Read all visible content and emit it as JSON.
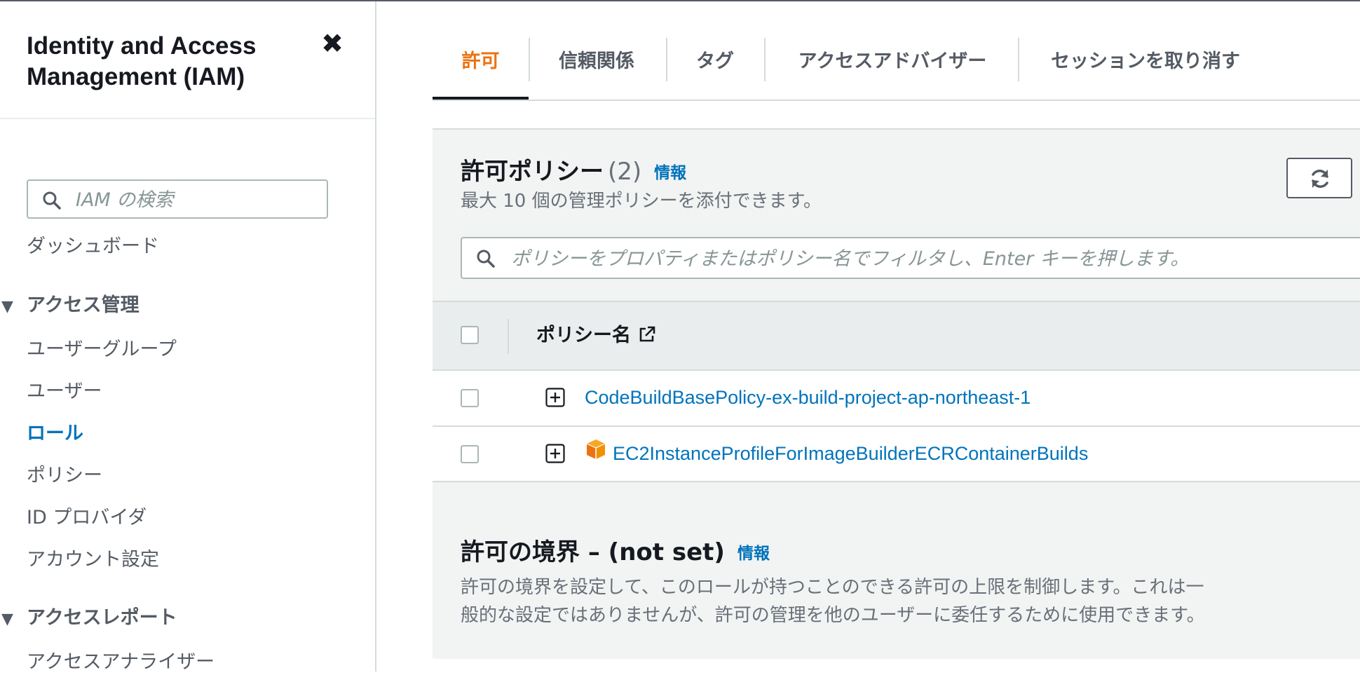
{
  "sidebar": {
    "title": "Identity and Access Management (IAM)",
    "close_icon": "close-icon",
    "search_placeholder": "IAM の検索",
    "dashboard": "ダッシュボード",
    "section_access_mgmt": "アクセス管理",
    "items": [
      {
        "label": "ユーザーグループ",
        "active": false
      },
      {
        "label": "ユーザー",
        "active": false
      },
      {
        "label": "ロール",
        "active": true
      },
      {
        "label": "ポリシー",
        "active": false
      },
      {
        "label": "ID プロバイダ",
        "active": false
      },
      {
        "label": "アカウント設定",
        "active": false
      }
    ],
    "section_access_reports": "アクセスレポート",
    "report_items": [
      "アクセスアナライザー"
    ]
  },
  "tabs": [
    {
      "label": "許可",
      "active": true
    },
    {
      "label": "信頼関係",
      "active": false
    },
    {
      "label": "タグ",
      "active": false
    },
    {
      "label": "アクセスアドバイザー",
      "active": false
    },
    {
      "label": "セッションを取り消す",
      "active": false
    }
  ],
  "permissions": {
    "title": "許可ポリシー",
    "count": "(2)",
    "info": "情報",
    "description": "最大 10 個の管理ポリシーを添付できます。",
    "filter_placeholder": "ポリシーをプロパティまたはポリシー名でフィルタし、Enter キーを押します。",
    "column_policy_name": "ポリシー名",
    "rows": [
      {
        "name": "CodeBuildBasePolicy-ex-build-project-ap-northeast-1",
        "aws_managed": false
      },
      {
        "name": "EC2InstanceProfileForImageBuilderECRContainerBuilds",
        "aws_managed": true
      }
    ]
  },
  "boundary": {
    "title": "許可の境界 – (not set)",
    "info": "情報",
    "description_line1": "許可の境界を設定して、このロールが持つことのできる許可の上限を制御します。これは一",
    "description_line2": "般的な設定ではありませんが、許可の管理を他のユーザーに委任するために使用できます。"
  },
  "colors": {
    "accent_orange": "#ec7211",
    "link_blue": "#0073bb",
    "panel_bg": "#f2f3f3"
  }
}
